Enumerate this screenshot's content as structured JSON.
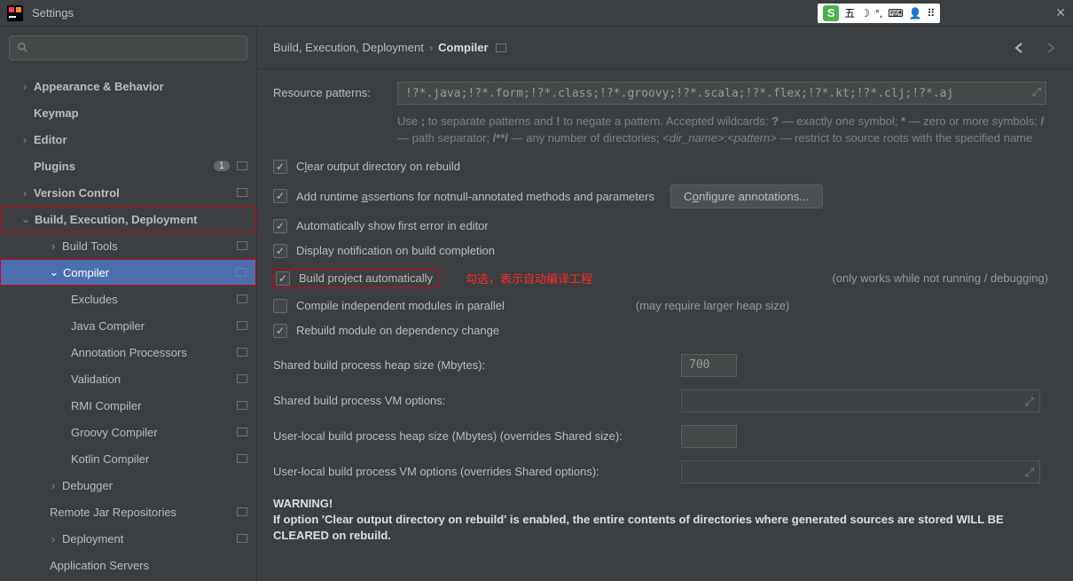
{
  "window": {
    "title": "Settings"
  },
  "ime": {
    "text": "五"
  },
  "sidebar": {
    "items": [
      {
        "label": "Appearance & Behavior",
        "bold": true
      },
      {
        "label": "Keymap",
        "bold": true
      },
      {
        "label": "Editor",
        "bold": true
      },
      {
        "label": "Plugins",
        "bold": true,
        "badge": "1"
      },
      {
        "label": "Version Control",
        "bold": true
      },
      {
        "label": "Build, Execution, Deployment",
        "bold": true
      },
      {
        "label": "Build Tools"
      },
      {
        "label": "Compiler"
      },
      {
        "label": "Excludes"
      },
      {
        "label": "Java Compiler"
      },
      {
        "label": "Annotation Processors"
      },
      {
        "label": "Validation"
      },
      {
        "label": "RMI Compiler"
      },
      {
        "label": "Groovy Compiler"
      },
      {
        "label": "Kotlin Compiler"
      },
      {
        "label": "Debugger"
      },
      {
        "label": "Remote Jar Repositories"
      },
      {
        "label": "Deployment"
      },
      {
        "label": "Application Servers"
      }
    ]
  },
  "breadcrumb": {
    "a": "Build, Execution, Deployment",
    "b": "Compiler"
  },
  "form": {
    "resource_label": "Resource patterns:",
    "resource_value": "!?*.java;!?*.form;!?*.class;!?*.groovy;!?*.scala;!?*.flex;!?*.kt;!?*.clj;!?*.aj",
    "help_p1": "Use ",
    "help_semi": ";",
    "help_p2": " to separate patterns and ",
    "help_bang": "!",
    "help_p3": " to negate a pattern. Accepted wildcards: ",
    "help_q": "?",
    "help_p4": " — exactly one symbol; ",
    "help_star": "*",
    "help_p5": " — zero or more symbols; ",
    "help_slash": "/",
    "help_p6": " — path separator; ",
    "help_dstar": "/**/",
    "help_p7": " — any number of directories; ",
    "help_dir": "<dir_name>",
    "help_colon": ":",
    "help_pat": "<pattern>",
    "help_p8": " — restrict to source roots with the specified name",
    "ck_clear": "Clear output directory on rebuild",
    "ck_clear_u": "l",
    "ck_runtime": "Add runtime assertions for notnull-annotated methods and parameters",
    "ck_runtime_pre": "Add runtime ",
    "ck_runtime_u": "a",
    "ck_runtime_post": "ssertions for notnull-annotated methods and parameters",
    "btn_conf_pre": "C",
    "btn_conf_u": "o",
    "btn_conf_post": "nfigure annotations...",
    "ck_first_error": "Automatically show first error in editor",
    "ck_notify": "Display notification on build completion",
    "ck_auto": "Build project automatically",
    "anno": "勾选，表示自动编译工程",
    "hint_auto": "(only works while not running / debugging)",
    "ck_parallel": "Compile independent modules in parallel",
    "hint_parallel": "(may require larger heap size)",
    "ck_rebuild": "Rebuild module on dependency change",
    "heap_label": "Shared build process heap size (Mbytes):",
    "heap_value": "700",
    "vm_label": "Shared build process VM options:",
    "uheap_label": "User-local build process heap size (Mbytes) (overrides Shared size):",
    "uvm_label": "User-local build process VM options (overrides Shared options):",
    "warn_title": "WARNING!",
    "warn_body": "If option 'Clear output directory on rebuild' is enabled, the entire contents of directories where generated sources are stored WILL BE CLEARED on rebuild."
  }
}
